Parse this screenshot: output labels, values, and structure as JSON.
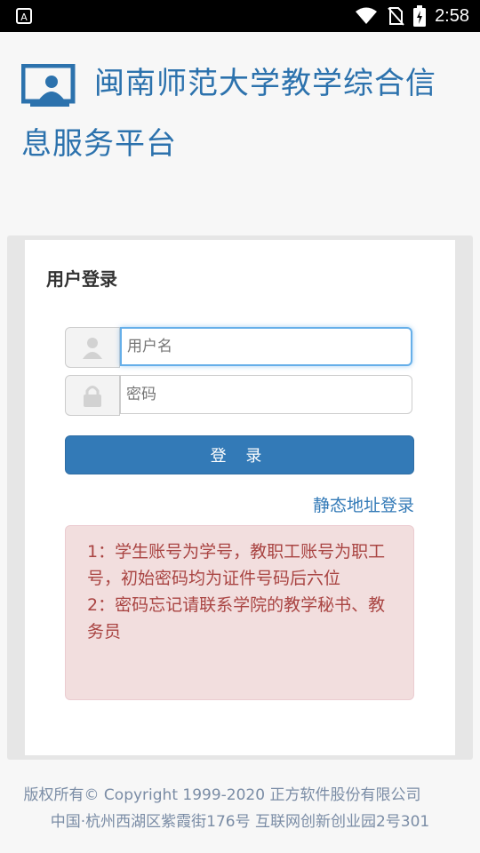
{
  "status_bar": {
    "time": "2:58",
    "icons": [
      "a-icon",
      "wifi-icon",
      "no-sim-icon",
      "battery-icon"
    ]
  },
  "header": {
    "title": "闽南师范大学教学综合信息服务平台",
    "logo_icon": "user-screen-icon",
    "accent": "#2c72ad"
  },
  "login": {
    "title": "用户登录",
    "username_placeholder": "用户名",
    "password_placeholder": "密码",
    "login_button": "登 录",
    "static_login_link": "静态地址登录"
  },
  "notice": {
    "lines": [
      "1：学生账号为学号，教职工账号为职工号，初始密码均为证件号码后六位",
      "2：密码忘记请联系学院的教学秘书、教务员"
    ]
  },
  "footer": {
    "copyright": "版权所有© Copyright 1999-2020 正方软件股份有限公司",
    "address": "中国·杭州西湖区紫霞街176号 互联网创新创业园2号301"
  },
  "colors": {
    "primary": "#337ab7",
    "alert_bg": "#f2dede",
    "alert_text": "#a94442"
  }
}
